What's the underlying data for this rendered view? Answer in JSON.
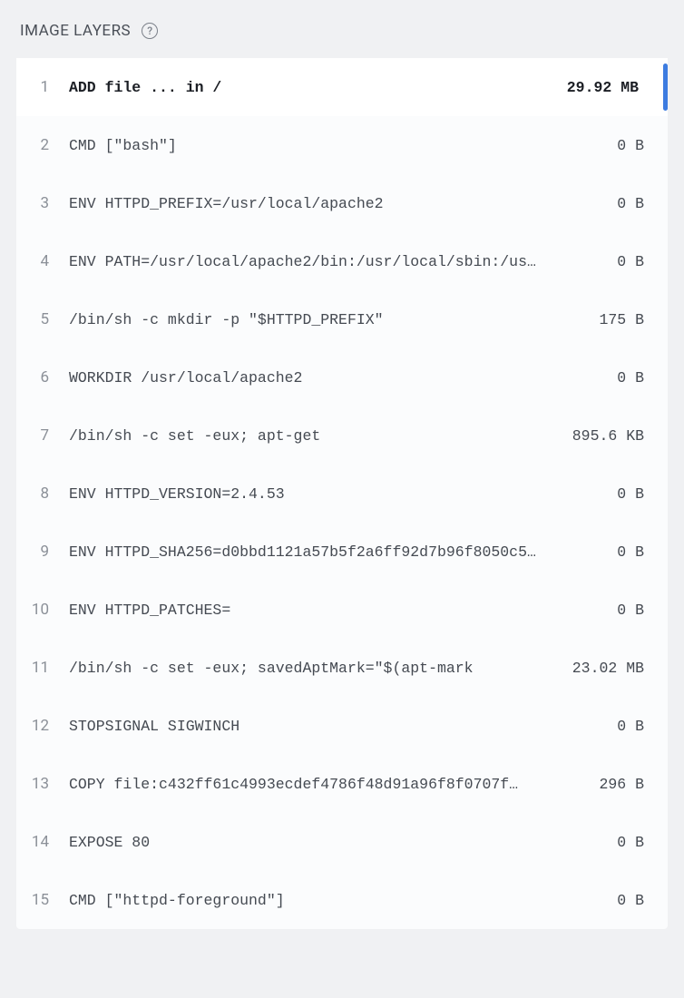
{
  "header": {
    "title": "IMAGE LAYERS",
    "help_symbol": "?"
  },
  "layers": [
    {
      "index": "1",
      "command": "ADD file ... in /",
      "size": "29.92 MB",
      "selected": true
    },
    {
      "index": "2",
      "command": "CMD [\"bash\"]",
      "size": "0 B",
      "selected": false
    },
    {
      "index": "3",
      "command": "ENV HTTPD_PREFIX=/usr/local/apache2",
      "size": "0 B",
      "selected": false
    },
    {
      "index": "4",
      "command": "ENV PATH=/usr/local/apache2/bin:/usr/local/sbin:/us…",
      "size": "0 B",
      "selected": false
    },
    {
      "index": "5",
      "command": "/bin/sh -c mkdir -p \"$HTTPD_PREFIX\"",
      "size": "175 B",
      "selected": false
    },
    {
      "index": "6",
      "command": "WORKDIR /usr/local/apache2",
      "size": "0 B",
      "selected": false
    },
    {
      "index": "7",
      "command": "/bin/sh -c set -eux; apt-get",
      "size": "895.6 KB",
      "selected": false
    },
    {
      "index": "8",
      "command": "ENV HTTPD_VERSION=2.4.53",
      "size": "0 B",
      "selected": false
    },
    {
      "index": "9",
      "command": "ENV HTTPD_SHA256=d0bbd1121a57b5f2a6ff92d7b96f8050c5…",
      "size": "0 B",
      "selected": false
    },
    {
      "index": "10",
      "command": "ENV HTTPD_PATCHES=",
      "size": "0 B",
      "selected": false
    },
    {
      "index": "11",
      "command": "/bin/sh -c set -eux; savedAptMark=\"$(apt-mark",
      "size": "23.02 MB",
      "selected": false
    },
    {
      "index": "12",
      "command": "STOPSIGNAL SIGWINCH",
      "size": "0 B",
      "selected": false
    },
    {
      "index": "13",
      "command": "COPY file:c432ff61c4993ecdef4786f48d91a96f8f0707f…",
      "size": "296 B",
      "selected": false
    },
    {
      "index": "14",
      "command": "EXPOSE 80",
      "size": "0 B",
      "selected": false
    },
    {
      "index": "15",
      "command": "CMD [\"httpd-foreground\"]",
      "size": "0 B",
      "selected": false
    }
  ]
}
